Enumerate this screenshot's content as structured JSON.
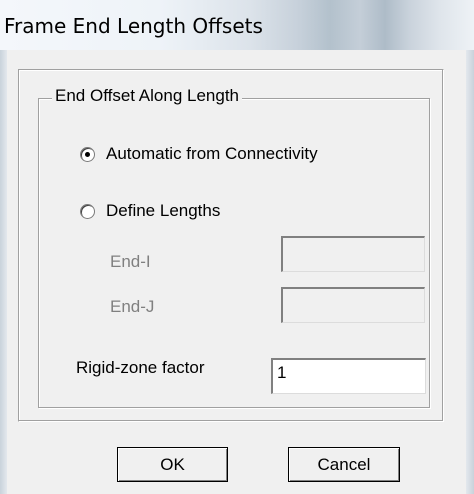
{
  "window": {
    "title": "Frame End Length Offsets"
  },
  "group": {
    "legend": "End Offset Along Length"
  },
  "options": {
    "automatic_label": "Automatic from Connectivity",
    "automatic_checked": true,
    "define_label": "Define Lengths",
    "define_checked": false
  },
  "fields": {
    "end_i_label": "End-I",
    "end_i_value": "",
    "end_j_label": "End-J",
    "end_j_value": "",
    "rigid_label": "Rigid-zone factor",
    "rigid_value": "1"
  },
  "buttons": {
    "ok_label": "OK",
    "cancel_label": "Cancel"
  }
}
